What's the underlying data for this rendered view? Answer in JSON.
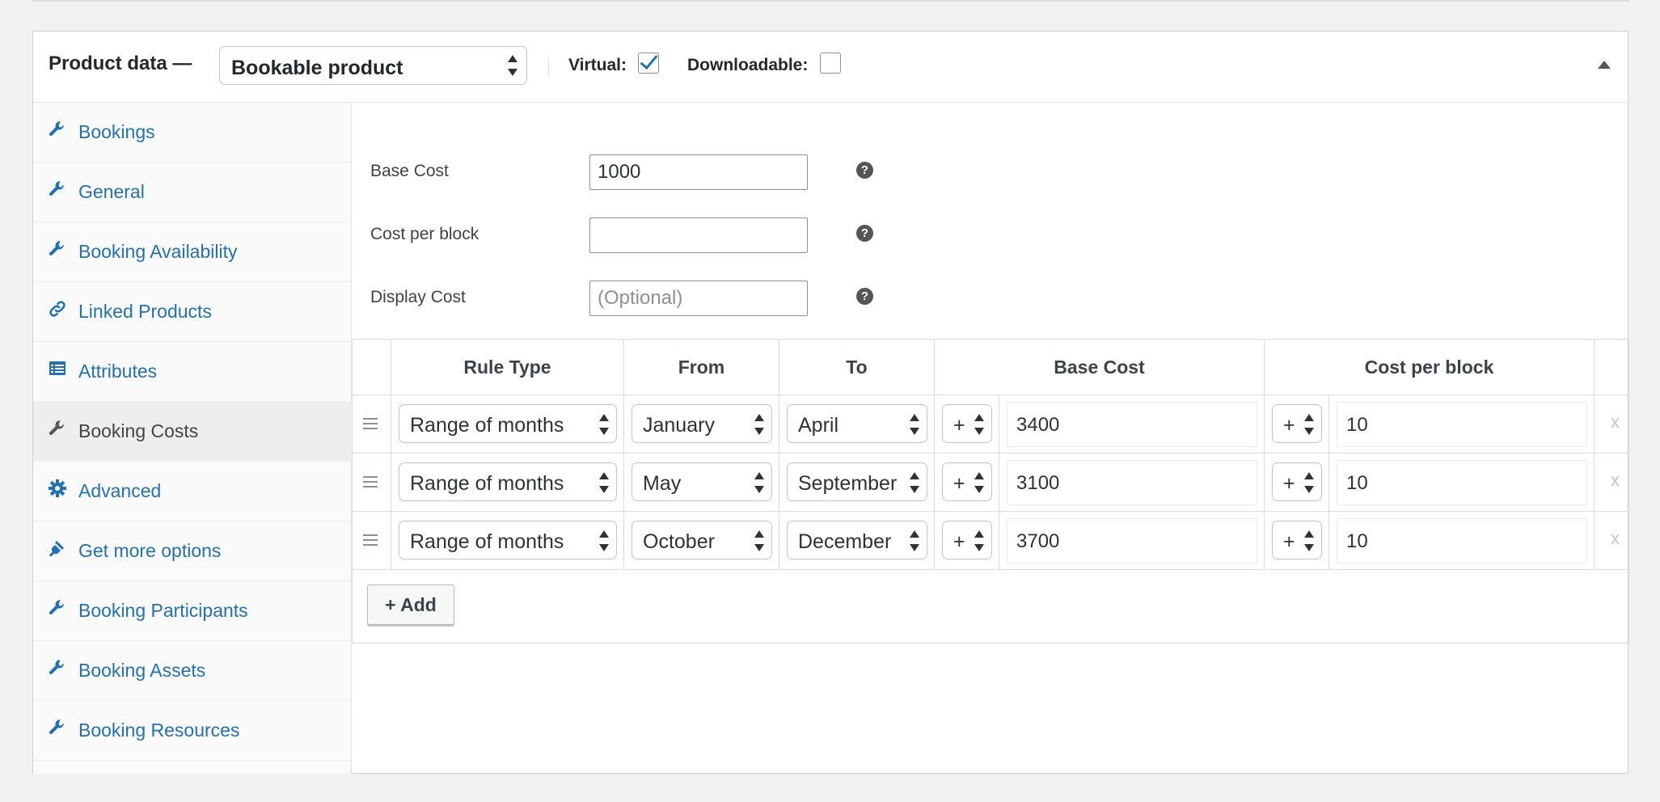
{
  "header": {
    "title": "Product data —",
    "product_type": "Bookable product",
    "virtual_label": "Virtual:",
    "virtual_checked": true,
    "downloadable_label": "Downloadable:",
    "downloadable_checked": false
  },
  "tabs": [
    {
      "label": "Bookings",
      "icon": "wrench-icon"
    },
    {
      "label": "General",
      "icon": "wrench-icon"
    },
    {
      "label": "Booking Availability",
      "icon": "wrench-icon"
    },
    {
      "label": "Linked Products",
      "icon": "link-icon"
    },
    {
      "label": "Attributes",
      "icon": "list-icon"
    },
    {
      "label": "Booking Costs",
      "icon": "wrench-icon",
      "active": true
    },
    {
      "label": "Advanced",
      "icon": "gear-icon"
    },
    {
      "label": "Get more options",
      "icon": "plugin-icon"
    },
    {
      "label": "Booking Participants",
      "icon": "wrench-icon"
    },
    {
      "label": "Booking Assets",
      "icon": "wrench-icon"
    },
    {
      "label": "Booking Resources",
      "icon": "wrench-icon"
    }
  ],
  "fields": {
    "base_cost": {
      "label": "Base Cost",
      "value": "1000"
    },
    "cost_per_block": {
      "label": "Cost per block",
      "value": ""
    },
    "display_cost": {
      "label": "Display Cost",
      "value": "",
      "placeholder": "(Optional)"
    },
    "help_glyph": "?"
  },
  "table": {
    "headers": {
      "rule_type": "Rule Type",
      "from": "From",
      "to": "To",
      "base_cost": "Base Cost",
      "cost_per_block": "Cost per block"
    },
    "rows": [
      {
        "rule_type": "Range of months",
        "from": "January",
        "to": "April",
        "base_op": "+",
        "base_cost": "3400",
        "block_op": "+",
        "block_cost": "10"
      },
      {
        "rule_type": "Range of months",
        "from": "May",
        "to": "September",
        "base_op": "+",
        "base_cost": "3100",
        "block_op": "+",
        "block_cost": "10"
      },
      {
        "rule_type": "Range of months",
        "from": "October",
        "to": "December",
        "base_op": "+",
        "base_cost": "3700",
        "block_op": "+",
        "block_cost": "10"
      }
    ],
    "delete_glyph": "x",
    "add_label": "+ Add"
  },
  "colors": {
    "link": "#2271b1",
    "active_tab_bg": "#eeeeee"
  }
}
